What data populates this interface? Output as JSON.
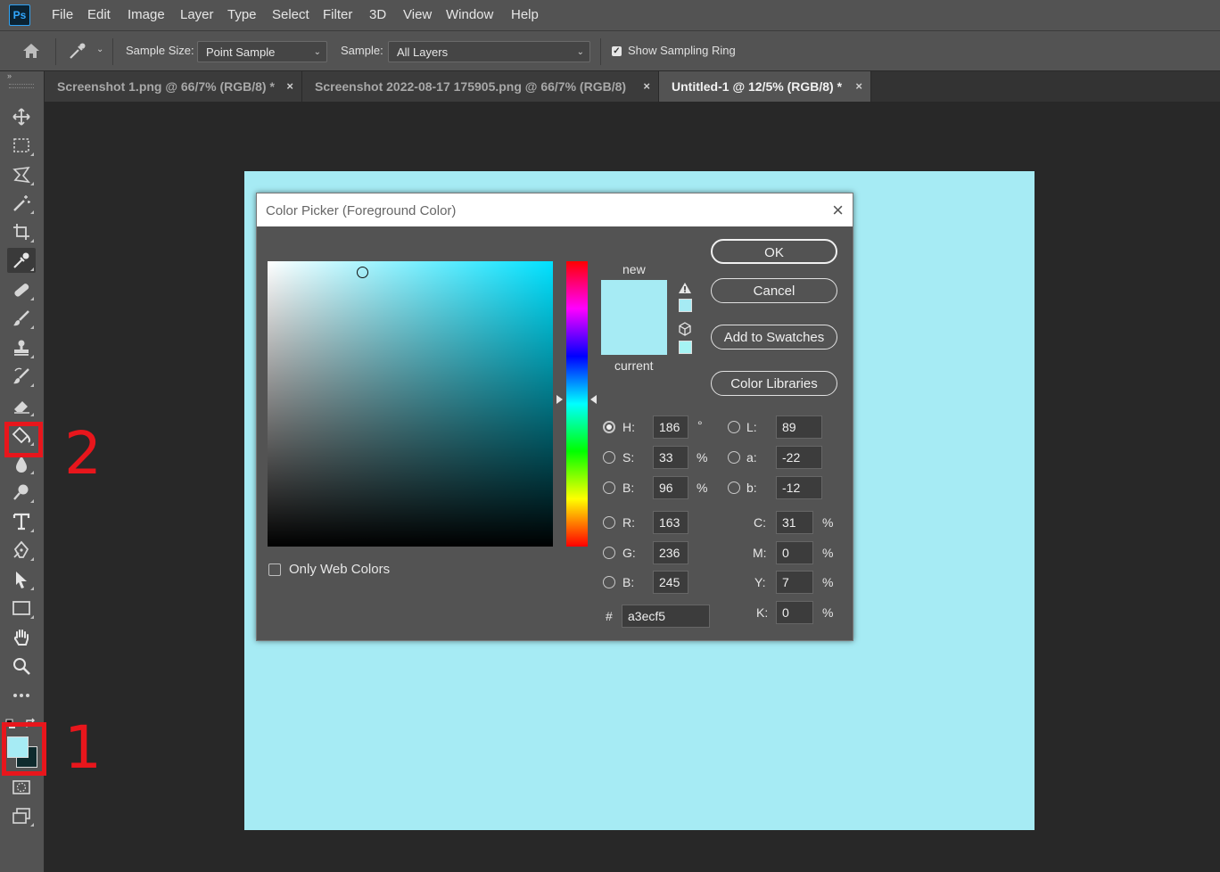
{
  "app": {
    "logo": "Ps"
  },
  "menu": [
    "File",
    "Edit",
    "Image",
    "Layer",
    "Type",
    "Select",
    "Filter",
    "3D",
    "View",
    "Window",
    "Help"
  ],
  "options": {
    "sample_size_label": "Sample Size:",
    "sample_size_value": "Point Sample",
    "sample_label": "Sample:",
    "sample_value": "All Layers",
    "show_ring_label": "Show Sampling Ring",
    "show_ring_checked": true
  },
  "tabs": [
    {
      "label": "Screenshot 1.png @ 66/7% (RGB/8) *",
      "close": "×",
      "active": false
    },
    {
      "label": "Screenshot 2022-08-17 175905.png @ 66/7% (RGB/8)",
      "close": "×",
      "active": false
    },
    {
      "label": "Untitled-1 @ 12/5% (RGB/8) *",
      "close": "×",
      "active": true
    }
  ],
  "tools": [
    "move-tool-icon",
    "marquee-tool-icon",
    "lasso-tool-icon",
    "magic-wand-icon",
    "crop-tool-icon",
    "eyedropper-icon",
    "healing-brush-icon",
    "brush-tool-icon",
    "clone-stamp-icon",
    "history-brush-icon",
    "eraser-icon",
    "paint-bucket-icon",
    "blur-tool-icon",
    "dodge-tool-icon",
    "type-tool-icon",
    "pen-tool-icon",
    "path-selection-icon",
    "rectangle-tool-icon",
    "hand-tool-icon",
    "zoom-tool-icon",
    "more-tools-icon"
  ],
  "document": {
    "fill_color": "#a6ebf4"
  },
  "dialog": {
    "title": "Color Picker (Foreground Color)",
    "close": "×",
    "new_label": "new",
    "current_label": "current",
    "buttons": {
      "ok": "OK",
      "cancel": "Cancel",
      "add_swatches": "Add to Swatches",
      "color_libraries": "Color Libraries"
    },
    "only_web_colors": "Only Web Colors",
    "hsb": {
      "h": {
        "label": "H:",
        "value": "186",
        "unit": "°"
      },
      "s": {
        "label": "S:",
        "value": "33",
        "unit": "%"
      },
      "b": {
        "label": "B:",
        "value": "96",
        "unit": "%"
      }
    },
    "rgb": {
      "r": {
        "label": "R:",
        "value": "163"
      },
      "g": {
        "label": "G:",
        "value": "236"
      },
      "b": {
        "label": "B:",
        "value": "245"
      }
    },
    "lab": {
      "l": {
        "label": "L:",
        "value": "89"
      },
      "a": {
        "label": "a:",
        "value": "-22"
      },
      "b": {
        "label": "b:",
        "value": "-12"
      }
    },
    "cmyk": {
      "c": {
        "label": "C:",
        "value": "31",
        "unit": "%"
      },
      "m": {
        "label": "M:",
        "value": "0",
        "unit": "%"
      },
      "y": {
        "label": "Y:",
        "value": "7",
        "unit": "%"
      },
      "k": {
        "label": "K:",
        "value": "0",
        "unit": "%"
      }
    },
    "hex_label": "#",
    "hex_value": "a3ecf5"
  },
  "annotations": {
    "one": "1",
    "two": "2"
  },
  "colors": {
    "foreground": "#a6ebf4",
    "background": "#0e2a2d",
    "annotation": "#e8161c"
  }
}
